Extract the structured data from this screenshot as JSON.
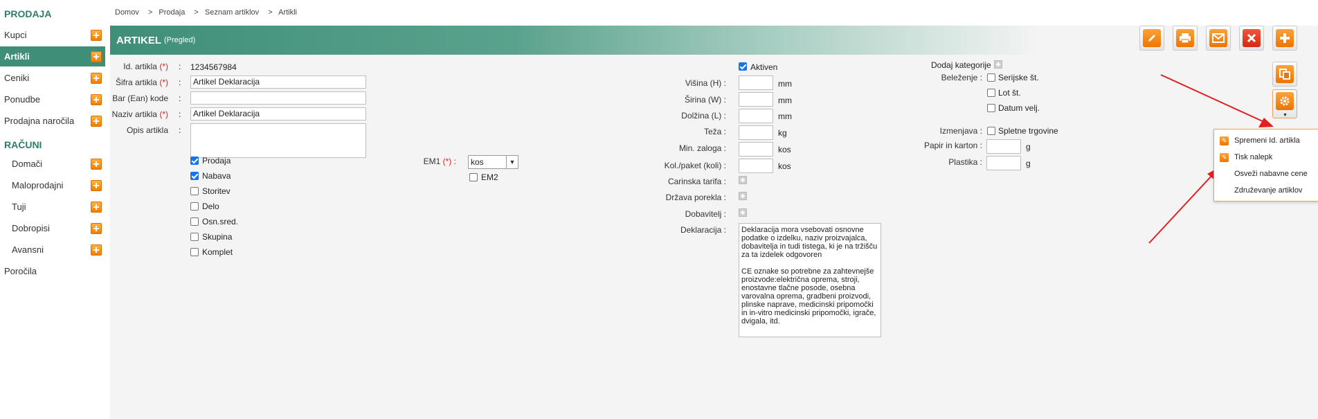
{
  "sidebar": {
    "sections": [
      {
        "title": "PRODAJA"
      },
      {
        "title": "RAČUNI"
      }
    ],
    "items": [
      {
        "label": "Kupci"
      },
      {
        "label": "Artikli"
      },
      {
        "label": "Ceniki"
      },
      {
        "label": "Ponudbe"
      },
      {
        "label": "Prodajna naročila"
      },
      {
        "label": "Domači"
      },
      {
        "label": "Maloprodajni"
      },
      {
        "label": "Tuji"
      },
      {
        "label": "Dobropisi"
      },
      {
        "label": "Avansni"
      },
      {
        "label": "Poročila"
      }
    ]
  },
  "breadcrumb": [
    "Domov",
    "Prodaja",
    "Seznam artiklov",
    "Artikli"
  ],
  "breadcrumb_sep": ">",
  "header": {
    "title": "ARTIKEL",
    "subtitle": "(Pregled)"
  },
  "toolbar_icons": [
    "edit-icon",
    "print-icon",
    "email-icon",
    "delete-icon",
    "add-icon",
    "copy-icon",
    "settings-icon"
  ],
  "form": {
    "id_label": "Id. artikla",
    "id_value": "1234567984",
    "sifra_label": "Šifra artikla",
    "sifra_value": "Artikel Deklaracija",
    "ean_label": "Bar (Ean) kode",
    "ean_value": "",
    "naziv_label": "Naziv artikla",
    "naziv_value": "Artikel Deklaracija",
    "opis_label": "Opis artikla",
    "opis_value": "",
    "req_mark": "(*)",
    "colon": ":",
    "checks": [
      {
        "label": "Prodaja",
        "checked": true
      },
      {
        "label": "Nabava",
        "checked": true
      },
      {
        "label": "Storitev",
        "checked": false
      },
      {
        "label": "Delo",
        "checked": false
      },
      {
        "label": "Osn.sred.",
        "checked": false
      },
      {
        "label": "Skupina",
        "checked": false
      },
      {
        "label": "Komplet",
        "checked": false
      }
    ],
    "em1_label": "EM1",
    "em1_value": "kos",
    "em2_label": "EM2",
    "aktiven_label": "Aktiven",
    "visina_label": "Višina (H)",
    "sirina_label": "Širina (W)",
    "dolzina_label": "Dolžina (L)",
    "teza_label": "Teža",
    "min_zaloga_label": "Min. zaloga",
    "kol_paket_label": "Kol./paket (koli)",
    "carinska_label": "Carinska tarifa",
    "drzava_label": "Država porekla",
    "dobavitelj_label": "Dobavitelj",
    "deklaracija_label": "Deklaracija",
    "deklaracija_text": "Deklaracija mora vsebovati osnovne podatke o izdelku, naziv proizvajalca, dobavitelja in tudi tistega, ki je na tržišču za ta izdelek odgovoren\n\nCE oznake so potrebne za zahtevnejše proizvode:električna oprema, stroji, enostavne tlačne posode, osebna varovalna oprema, gradbeni proizvodi, plinske naprave, medicinski pripomočki in in-vitro medicinski pripomočki, igrače, dvigala, itd.",
    "unit_mm": "mm",
    "unit_kg": "kg",
    "unit_kos": "kos",
    "dodaj_kategorije": "Dodaj kategorije",
    "belezenje_label": "Beleženje",
    "serijske": "Serijske št.",
    "lot": "Lot št.",
    "datum_velj": "Datum velj.",
    "izmenjava_label": "Izmenjava",
    "spletne": "Spletne trgovine",
    "papir_label": "Papir in karton",
    "plastika_label": "Plastika",
    "unit_g": "g"
  },
  "dropdown": [
    {
      "label": "Spremeni Id. artikla"
    },
    {
      "label": "Tisk nalepk"
    },
    {
      "label": "Osveži nabavne cene"
    },
    {
      "label": "Združevanje artiklov"
    }
  ],
  "colors": {
    "accent": "#3f8f78",
    "orange": "#ef7400",
    "red": "#d32a13"
  }
}
